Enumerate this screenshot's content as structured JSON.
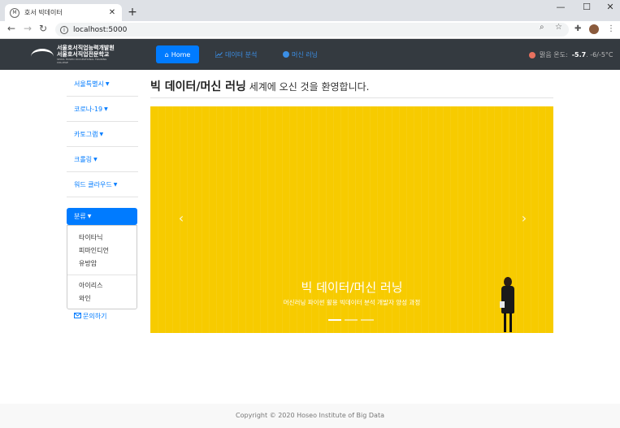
{
  "browser": {
    "tab_title": "호서 빅데이터",
    "tab_favicon": "M",
    "new_tab": "+",
    "close_tab": "✕",
    "url": "localhost:5000",
    "window_controls": {
      "minimize": "—",
      "maximize": "☐",
      "close": "✕"
    },
    "nav": {
      "back": "←",
      "forward": "→",
      "reload": "↻"
    }
  },
  "navbar": {
    "logo_text_1": "서울호서직업능력개발원",
    "logo_text_2": "서울호서직업전문학교",
    "logo_sub": "SEOUL HOSEO OCCUPATIONAL TRAINING COLLEGE",
    "home_label": "Home",
    "links": [
      {
        "label": "데이터 분석",
        "icon": "chart-icon"
      },
      {
        "label": "머신 러닝",
        "icon": "globe-icon"
      }
    ],
    "temperature": {
      "label": "맑음 온도:",
      "value": "-5.7",
      "range": ". -6/-5°C",
      "status_color": "#e8715f"
    }
  },
  "sidebar": {
    "items": [
      {
        "label": "서울특별시"
      },
      {
        "label": "코로나-19"
      },
      {
        "label": "카토그램"
      },
      {
        "label": "크롤링"
      },
      {
        "label": "워드 클라우드"
      }
    ],
    "dropdown": {
      "label": "분류",
      "group1": [
        "타이타닉",
        "피마인디언",
        "유방암"
      ],
      "group2": [
        "아이리스",
        "와인"
      ]
    },
    "contact_label": "문의하기"
  },
  "main": {
    "heading_bold": "빅 데이터/머신 러닝",
    "heading_rest": " 세계에 오신 것을 환영합니다.",
    "carousel": {
      "title": "빅 데이터/머신 러닝",
      "subtitle": "머신러닝 파이썬 활용 빅데이터 분석 개발자 양성 과정",
      "prev": "‹",
      "next": "›",
      "background_color": "#f7cb00",
      "slides": 3,
      "active_slide": 1
    }
  },
  "footer": {
    "copyright": "Copyright © 2020 Hoseo Institute of Big Data"
  },
  "colors": {
    "primary": "#007bff",
    "navbar_bg": "#343a40"
  }
}
